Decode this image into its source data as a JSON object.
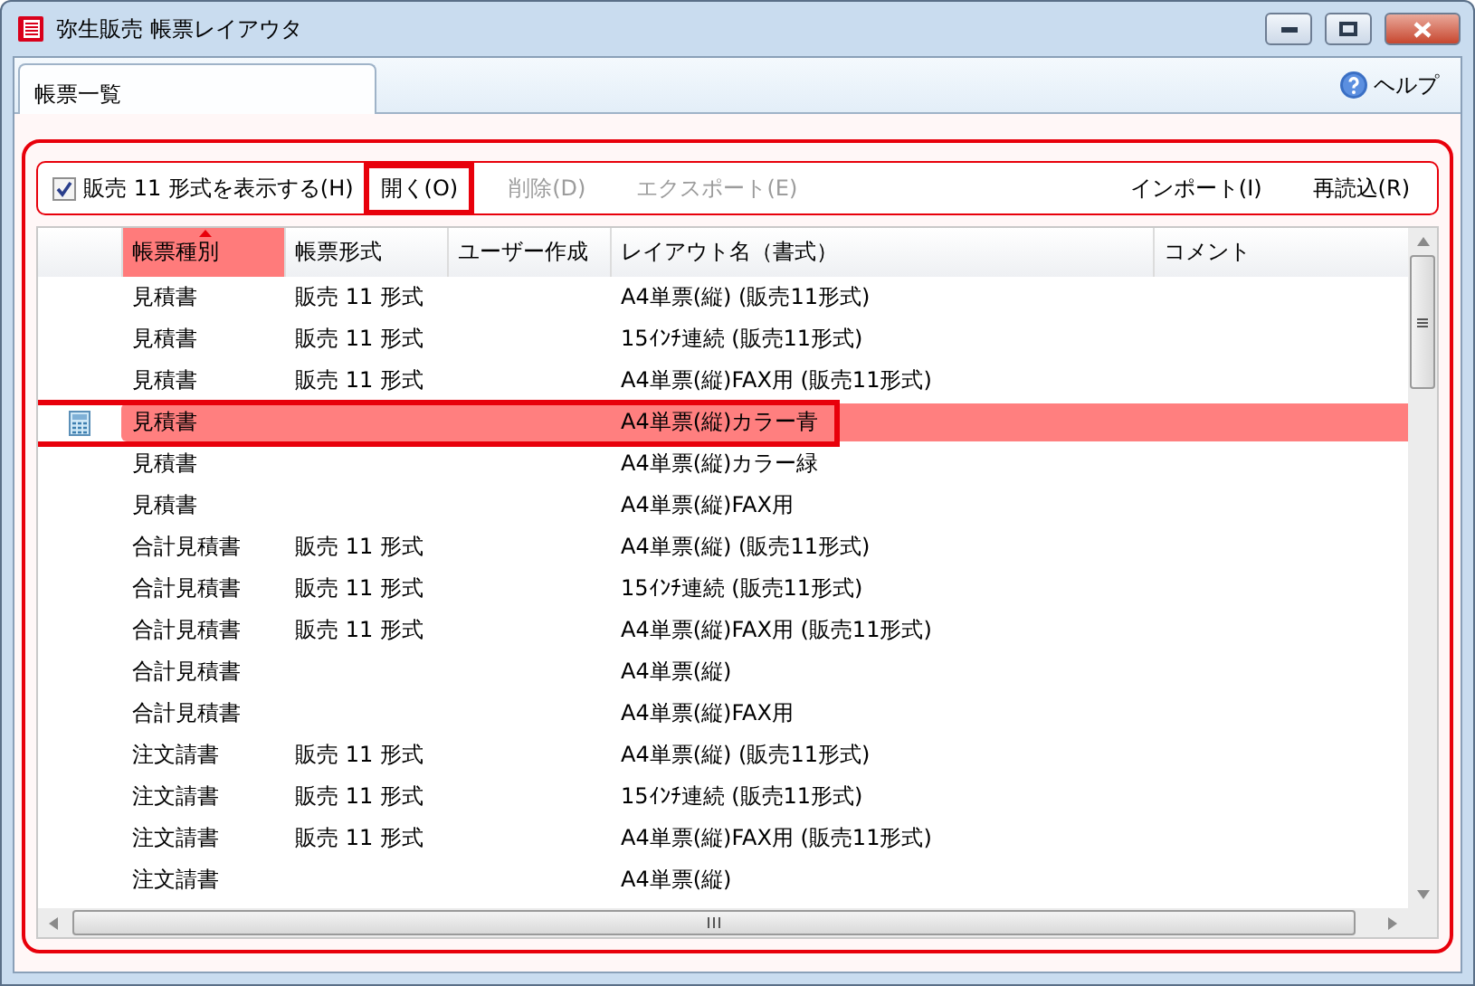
{
  "window": {
    "title": "弥生販売 帳票レイアウタ"
  },
  "tabs": [
    {
      "label": "帳票一覧",
      "selected": true
    }
  ],
  "help": {
    "label": "ヘルプ"
  },
  "toolbar": {
    "checkbox": {
      "label": "販売 11 形式を表示する(H)",
      "checked": true
    },
    "left_buttons": [
      {
        "label": "開く(O)",
        "disabled": false,
        "highlighted": true
      },
      {
        "label": "削除(D)",
        "disabled": true,
        "highlighted": false
      },
      {
        "label": "エクスポート(E)",
        "disabled": true,
        "highlighted": false
      }
    ],
    "right_buttons": [
      {
        "label": "インポート(I)",
        "disabled": false,
        "highlighted": false
      },
      {
        "label": "再読込(R)",
        "disabled": false,
        "highlighted": false
      }
    ]
  },
  "table": {
    "columns": [
      {
        "label": "帳票種別",
        "sorted": true
      },
      {
        "label": "帳票形式",
        "sorted": false
      },
      {
        "label": "ユーザー作成",
        "sorted": false
      },
      {
        "label": "レイアウト名（書式）",
        "sorted": false
      },
      {
        "label": "コメント",
        "sorted": false
      }
    ],
    "rows": [
      {
        "selected": false,
        "cells": [
          "見積書",
          "販売 11 形式",
          "",
          "A4単票(縦) (販売11形式)",
          ""
        ]
      },
      {
        "selected": false,
        "cells": [
          "見積書",
          "販売 11 形式",
          "",
          "15ｲﾝﾁ連続 (販売11形式)",
          ""
        ]
      },
      {
        "selected": false,
        "cells": [
          "見積書",
          "販売 11 形式",
          "",
          "A4単票(縦)FAX用 (販売11形式)",
          ""
        ]
      },
      {
        "selected": true,
        "cells": [
          "見積書",
          "",
          "",
          "A4単票(縦)カラー青",
          ""
        ]
      },
      {
        "selected": false,
        "cells": [
          "見積書",
          "",
          "",
          "A4単票(縦)カラー緑",
          ""
        ]
      },
      {
        "selected": false,
        "cells": [
          "見積書",
          "",
          "",
          "A4単票(縦)FAX用",
          ""
        ]
      },
      {
        "selected": false,
        "cells": [
          "合計見積書",
          "販売 11 形式",
          "",
          "A4単票(縦) (販売11形式)",
          ""
        ]
      },
      {
        "selected": false,
        "cells": [
          "合計見積書",
          "販売 11 形式",
          "",
          "15ｲﾝﾁ連続 (販売11形式)",
          ""
        ]
      },
      {
        "selected": false,
        "cells": [
          "合計見積書",
          "販売 11 形式",
          "",
          "A4単票(縦)FAX用 (販売11形式)",
          ""
        ]
      },
      {
        "selected": false,
        "cells": [
          "合計見積書",
          "",
          "",
          "A4単票(縦)",
          ""
        ]
      },
      {
        "selected": false,
        "cells": [
          "合計見積書",
          "",
          "",
          "A4単票(縦)FAX用",
          ""
        ]
      },
      {
        "selected": false,
        "cells": [
          "注文請書",
          "販売 11 形式",
          "",
          "A4単票(縦) (販売11形式)",
          ""
        ]
      },
      {
        "selected": false,
        "cells": [
          "注文請書",
          "販売 11 形式",
          "",
          "15ｲﾝﾁ連続 (販売11形式)",
          ""
        ]
      },
      {
        "selected": false,
        "cells": [
          "注文請書",
          "販売 11 形式",
          "",
          "A4単票(縦)FAX用 (販売11形式)",
          ""
        ]
      },
      {
        "selected": false,
        "cells": [
          "注文請書",
          "",
          "",
          "A4単票(縦)",
          ""
        ]
      }
    ]
  }
}
